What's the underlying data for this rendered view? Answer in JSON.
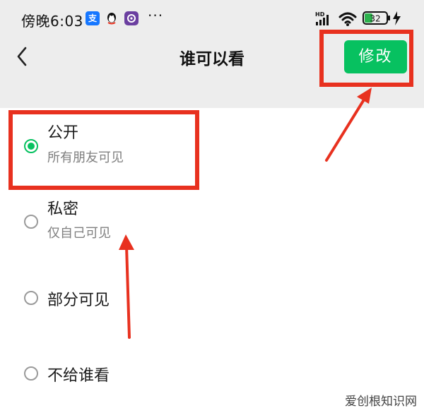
{
  "status_bar": {
    "time": "傍晚6:03",
    "left_icons": [
      "alipay-icon",
      "qq-icon",
      "app-icon"
    ],
    "more": "···",
    "network_label": "HD",
    "battery": "32"
  },
  "nav": {
    "title": "谁可以看",
    "edit_label": "修改",
    "back_icon": "chevron-left-icon"
  },
  "options": [
    {
      "label": "公开",
      "sublabel": "所有朋友可见",
      "selected": true
    },
    {
      "label": "私密",
      "sublabel": "仅自己可见",
      "selected": false
    },
    {
      "label": "部分可见",
      "selected": false
    },
    {
      "label": "不给谁看",
      "selected": false
    }
  ],
  "colors": {
    "accent_green": "#07c160",
    "annotation_red": "#e8311f",
    "header_bg": "#ededed"
  },
  "watermark": "爱创根知识网"
}
